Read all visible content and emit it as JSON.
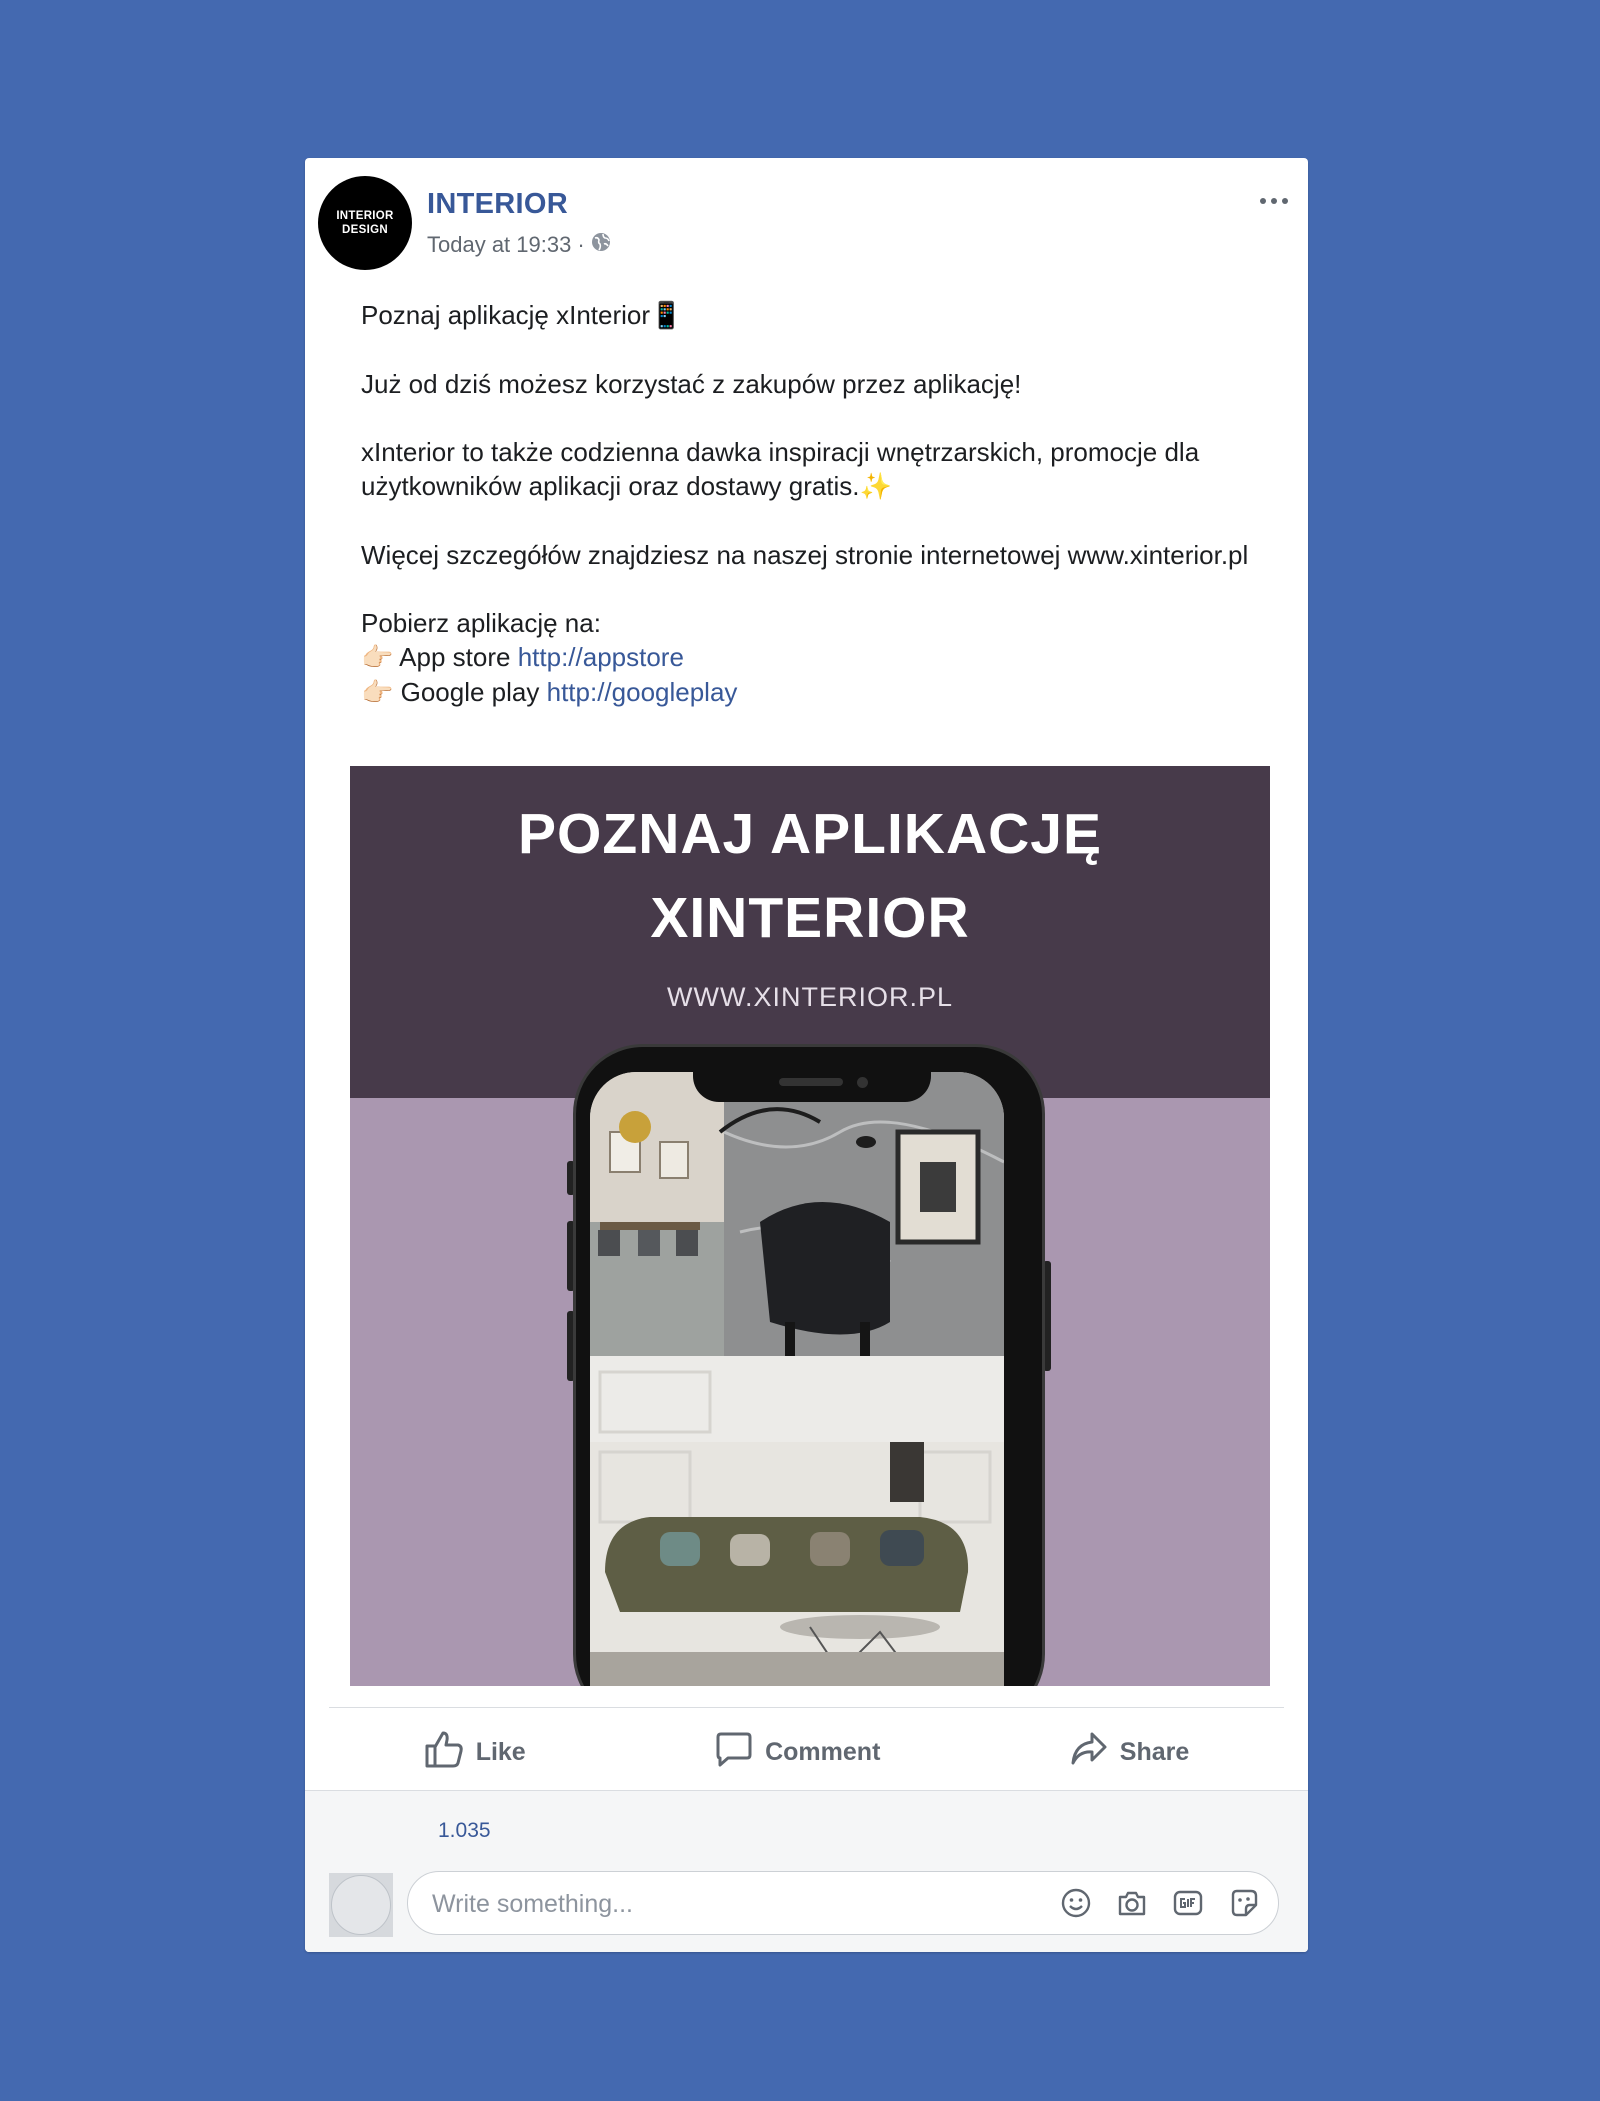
{
  "post": {
    "page_name": "INTERIOR",
    "avatar_line1": "INTERIOR",
    "avatar_line2": "DESIGN",
    "timestamp": "Today at 19:33",
    "separator": "·",
    "audience_icon": "globe-icon",
    "more_icon": "more-options-icon",
    "text": {
      "line1": "Poznaj aplikację xInterior",
      "line1_emoji": "📱",
      "line2": "Już od dziś możesz korzystać z zakupów przez aplikację!",
      "line3": "xInterior to także codzienna dawka inspiracji wnętrzarskich, promocje dla użytkowników aplikacji oraz dostawy gratis.",
      "line3_emoji": "✨",
      "line4": "Więcej szczegółów znajdziesz na naszej stronie internetowej www.xinterior.pl",
      "line5": "Pobierz aplikację na:",
      "pointer_emoji": "👉🏻",
      "appstore_label": "App store",
      "appstore_link": "http://appstore",
      "googleplay_label": "Google play",
      "googleplay_link": "http://googleplay"
    },
    "image": {
      "title_line1": "POZNAJ APLIKACJĘ",
      "title_line2": "XINTERIOR",
      "url": "WWW.XINTERIOR.PL",
      "top_color": "#473a4a",
      "bottom_color": "#aa97b0"
    }
  },
  "actions": {
    "like": "Like",
    "comment": "Comment",
    "share": "Share"
  },
  "footer": {
    "reactions_count": "1.035",
    "comment_placeholder": "Write something...",
    "icons": [
      "emoji-icon",
      "camera-icon",
      "gif-icon",
      "sticker-icon"
    ]
  },
  "colors": {
    "background": "#4469b0",
    "link": "#385898",
    "secondary_text": "#606770"
  }
}
